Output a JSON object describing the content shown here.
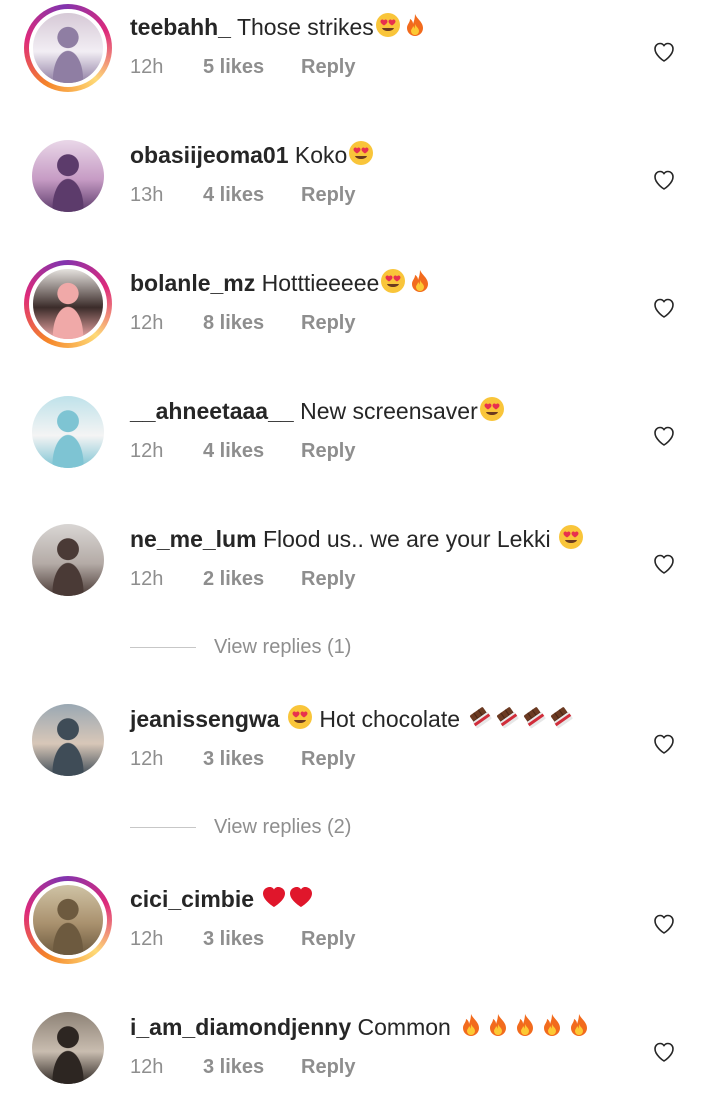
{
  "comments": [
    {
      "username": "teebahh_",
      "text": "Those strikes",
      "emojis": [
        "heart-eyes",
        "fire"
      ],
      "time": "12h",
      "likes": "5 likes",
      "reply": "Reply",
      "story": true,
      "avatar_colors": [
        "#d6c9d6",
        "#8f7ea3",
        "#f2eef4"
      ]
    },
    {
      "username": "obasiijeoma01",
      "text": "Koko",
      "emojis": [
        "heart-eyes"
      ],
      "time": "13h",
      "likes": "4 likes",
      "reply": "Reply",
      "story": false,
      "avatar_colors": [
        "#e9d7e8",
        "#5c3b6b",
        "#c69bc4"
      ]
    },
    {
      "username": "bolanle_mz",
      "text": "Hotttieeeee",
      "emojis": [
        "heart-eyes",
        "fire"
      ],
      "time": "12h",
      "likes": "8 likes",
      "reply": "Reply",
      "story": true,
      "avatar_colors": [
        "#e5e2de",
        "#f0a9a8",
        "#3b2c2a"
      ]
    },
    {
      "username": "__ahneetaaa__",
      "text": "New screensaver",
      "emojis": [
        "heart-eyes"
      ],
      "time": "12h",
      "likes": "4 likes",
      "reply": "Reply",
      "story": false,
      "avatar_colors": [
        "#bfe2ea",
        "#7ec4d3",
        "#f4f4f4"
      ]
    },
    {
      "username": "ne_me_lum",
      "text": "Flood us.. we are your Lekki ",
      "emojis": [
        "heart-eyes"
      ],
      "time": "12h",
      "likes": "2 likes",
      "reply": "Reply",
      "story": false,
      "avatar_colors": [
        "#d9d6d4",
        "#4a3a36",
        "#b4aba6"
      ]
    },
    {
      "username": "jeanissengwa",
      "text": " Hot chocolate ",
      "emojis_before": [
        "heart-eyes"
      ],
      "emojis": [
        "chocolate",
        "chocolate",
        "chocolate",
        "chocolate"
      ],
      "time": "12h",
      "likes": "3 likes",
      "reply": "Reply",
      "story": false,
      "avatar_colors": [
        "#9aa8b3",
        "#3f4c57",
        "#d8c7b8"
      ]
    },
    {
      "username": "cici_cimbie",
      "text": "",
      "emojis": [
        "red-heart",
        "red-heart"
      ],
      "time": "12h",
      "likes": "3 likes",
      "reply": "Reply",
      "story": true,
      "avatar_colors": [
        "#cfc3a5",
        "#6d5a3f",
        "#a9916e"
      ]
    },
    {
      "username": "i_am_diamondjenny",
      "text": "Common ",
      "emojis": [
        "fire",
        "fire",
        "fire",
        "fire",
        "fire"
      ],
      "time": "12h",
      "likes": "3 likes",
      "reply": "Reply",
      "story": false,
      "avatar_colors": [
        "#8d8276",
        "#2d2622",
        "#c9bdb0"
      ]
    }
  ],
  "view_replies": [
    {
      "after_index": 4,
      "label": "View replies (1)"
    },
    {
      "after_index": 5,
      "label": "View replies (2)"
    }
  ],
  "like_icon": "heart-outline-icon"
}
